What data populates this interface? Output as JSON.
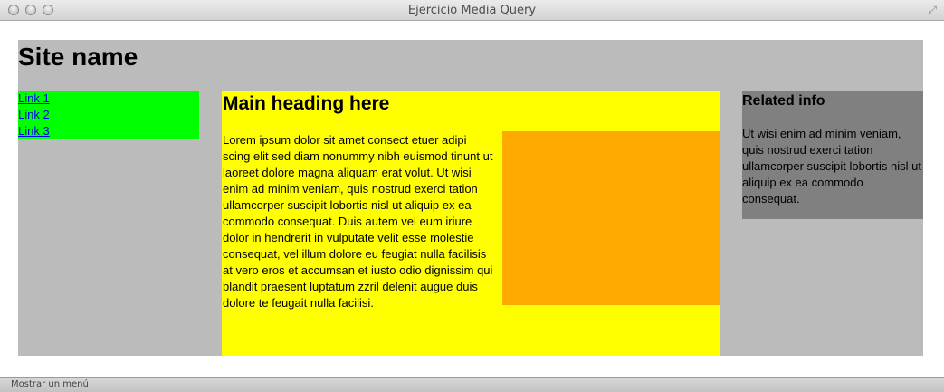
{
  "window": {
    "title": "Ejercicio Media Query"
  },
  "statusbar": {
    "text": "Mostrar un menú"
  },
  "page": {
    "site_name": "Site name",
    "nav": {
      "links": [
        "Link 1",
        "Link 2",
        "Link 3"
      ]
    },
    "main": {
      "heading": "Main heading here",
      "body": "Lorem ipsum dolor sit amet consect etuer adipi scing elit sed diam nonummy nibh euismod tinunt ut laoreet dolore magna aliquam erat volut. Ut wisi enim ad minim veniam, quis nostrud exerci tation ullamcorper suscipit lobortis nisl ut aliquip ex ea commodo consequat. Duis autem vel eum iriure dolor in hendrerit in vulputate velit esse molestie consequat, vel illum dolore eu feugiat nulla facilisis at vero eros et accumsan et iusto odio dignissim qui blandit praesent luptatum zzril delenit augue duis dolore te feugait nulla facilisi."
    },
    "aside": {
      "heading": "Related info",
      "body": "Ut wisi enim ad minim veniam, quis nostrud exerci tation ullamcorper suscipit lobortis nisl ut aliquip ex ea commodo consequat."
    }
  },
  "colors": {
    "page_bg": "#bbbbbb",
    "nav_bg": "#00ff00",
    "main_bg": "#ffff00",
    "box_bg": "#ffaa00",
    "aside_bg": "#808080",
    "link": "#0000ee"
  },
  "icons": {
    "window_controls": [
      "close-icon",
      "minimize-icon",
      "zoom-icon"
    ],
    "fullscreen": "fullscreen-icon"
  }
}
